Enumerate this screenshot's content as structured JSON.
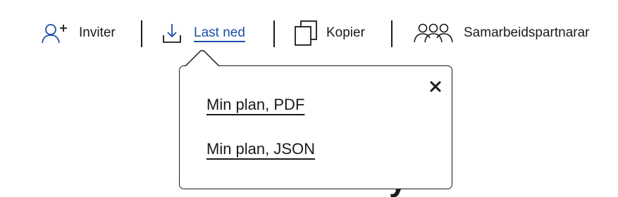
{
  "toolbar": {
    "invite_label": "Inviter",
    "download_label": "Last ned",
    "copy_label": "Kopier",
    "collaborators_label": "Samarbeidspartnarar",
    "accent_color": "#1c4fa8"
  },
  "download_menu": {
    "items": [
      {
        "label": "Min plan, PDF"
      },
      {
        "label": "Min plan, JSON"
      }
    ],
    "close_icon": "close-icon"
  },
  "background": {
    "partial_text": "y"
  }
}
